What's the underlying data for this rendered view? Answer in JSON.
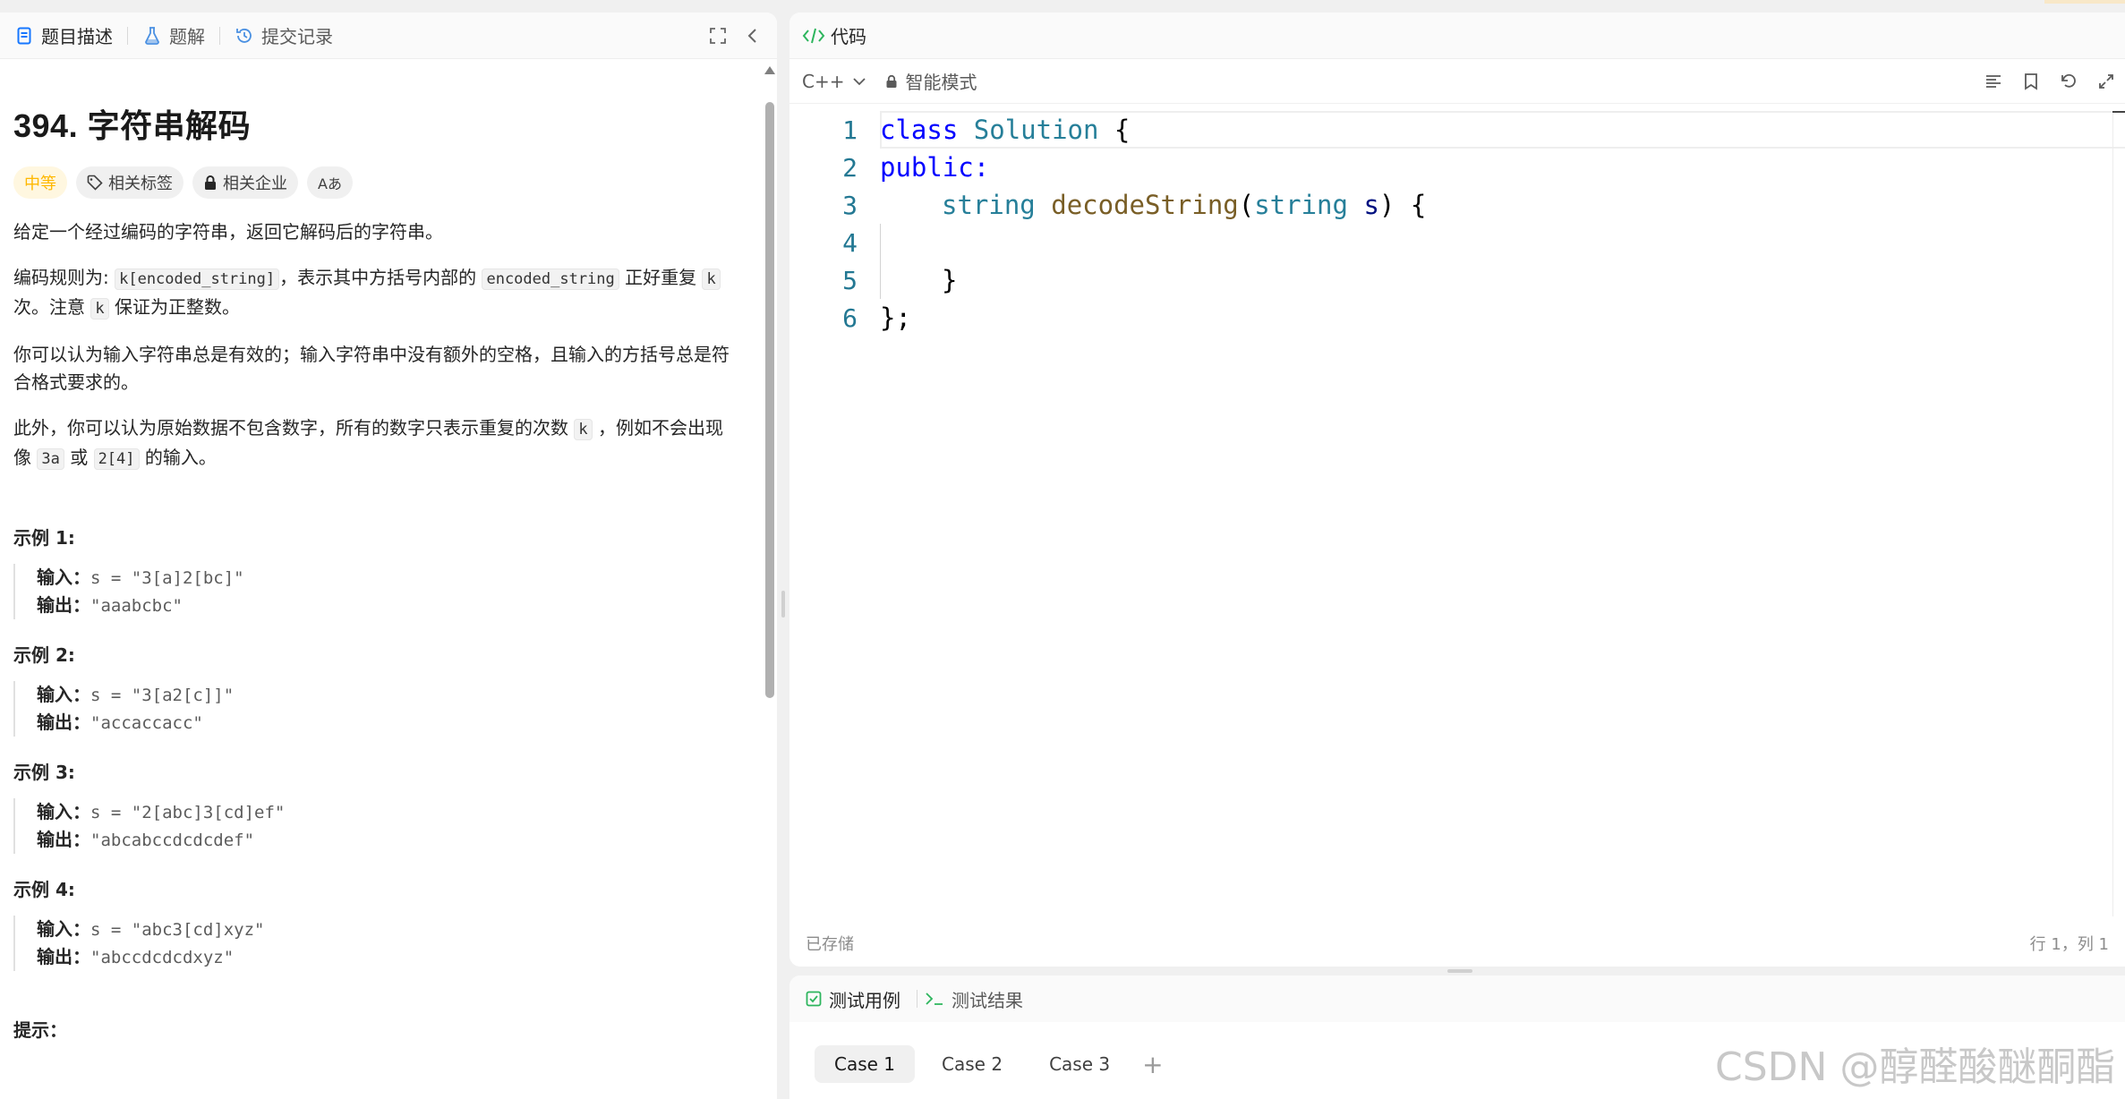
{
  "left_panel": {
    "tabs": {
      "description": "题目描述",
      "solutions": "题解",
      "submissions": "提交记录"
    },
    "problem": {
      "title": "394. 字符串解码",
      "tags": {
        "difficulty": "中等",
        "related_tags": "相关标签",
        "related_companies": "相关企业",
        "translate": "Aあ"
      },
      "p1": "给定一个经过编码的字符串，返回它解码后的字符串。",
      "p2": {
        "a": "编码规则为: ",
        "code1": "k[encoded_string]",
        "b": "，表示其中方括号内部的 ",
        "code2": "encoded_string",
        "c": " 正好重复 ",
        "code3": "k",
        "d": " 次。注意 ",
        "code4": "k",
        "e": " 保证为正整数。"
      },
      "p3": "你可以认为输入字符串总是有效的；输入字符串中没有额外的空格，且输入的方括号总是符合格式要求的。",
      "p4": {
        "a": "此外，你可以认为原始数据不包含数字，所有的数字只表示重复的次数 ",
        "code1": "k",
        "b": " ，例如不会出现像 ",
        "code2": "3a",
        "c": " 或 ",
        "code3": "2[4]",
        "d": " 的输入。"
      },
      "examples": [
        {
          "heading": "示例 1:",
          "input_label": "输入：",
          "input": "s = \"3[a]2[bc]\"",
          "output_label": "输出：",
          "output": "\"aaabcbc\""
        },
        {
          "heading": "示例 2:",
          "input_label": "输入：",
          "input": "s = \"3[a2[c]]\"",
          "output_label": "输出：",
          "output": "\"accaccacc\""
        },
        {
          "heading": "示例 3:",
          "input_label": "输入：",
          "input": "s = \"2[abc]3[cd]ef\"",
          "output_label": "输出：",
          "output": "\"abcabccdcdcdef\""
        },
        {
          "heading": "示例 4:",
          "input_label": "输入：",
          "input": "s = \"abc3[cd]xyz\"",
          "output_label": "输出：",
          "output": "\"abccdcdcdxyz\""
        }
      ],
      "hint_partial": "提示："
    }
  },
  "code_panel": {
    "title": "代码",
    "language": "C++",
    "mode": "智能模式",
    "line_numbers": [
      "1",
      "2",
      "3",
      "4",
      "5",
      "6"
    ],
    "code": {
      "l1_kw": "class",
      "l1_type": "Solution",
      "l1_rest": " {",
      "l2_kw": "public",
      "l2_rest": ":",
      "l3_type1": "string",
      "l3_fn": "decodeString",
      "l3_p1": "(",
      "l3_type2": "string",
      "l3_param": "s",
      "l3_rest": ") {",
      "l5": "}",
      "l6": "};"
    },
    "status_left": "已存储",
    "status_right": "行 1，列 1"
  },
  "bottom_panel": {
    "tab_testcase": "测试用例",
    "tab_result": "测试结果",
    "cases": [
      "Case 1",
      "Case 2",
      "Case 3"
    ],
    "add_case": "+"
  },
  "watermark": "CSDN @醇醛酸醚酮酯",
  "colors": {
    "accent_green": "#2db55d",
    "difficulty_yellow": "#ffb800",
    "keyword_blue": "#0000ff",
    "type_teal": "#267f99",
    "function_brown": "#795e26",
    "line_number": "#237893"
  }
}
